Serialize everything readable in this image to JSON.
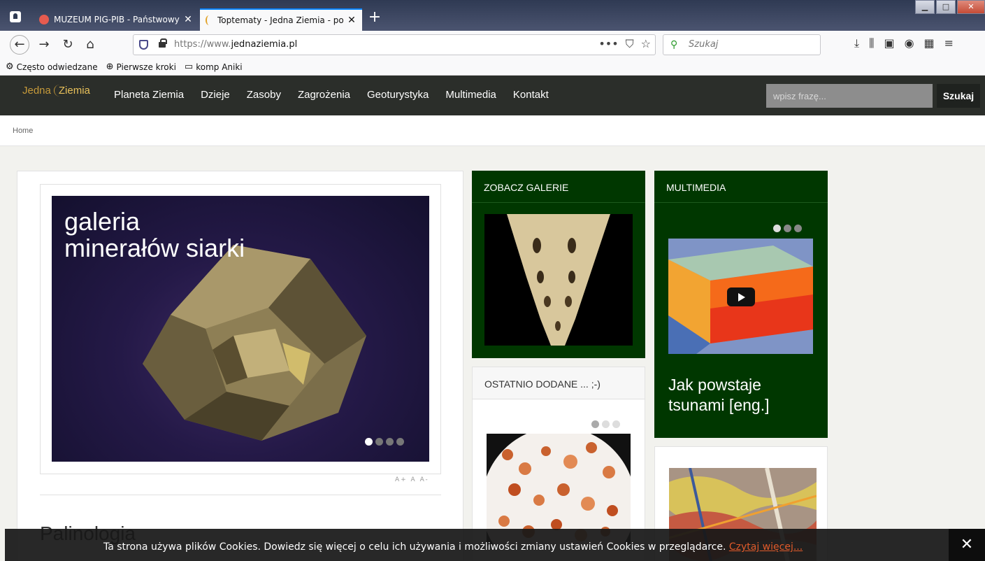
{
  "browser": {
    "tabs": [
      {
        "label": "MUZEUM PIG-PIB - Państwowy",
        "active": false
      },
      {
        "label": "Toptematy - Jedna Ziemia - po",
        "active": true
      }
    ],
    "url_proto": "https://www.",
    "url_host": "jednaziemia.pl",
    "search_placeholder": "Szukaj",
    "bookmarks": [
      "Często odwiedzane",
      "Pierwsze kroki",
      "komp Aniki"
    ]
  },
  "site": {
    "logo_part1": "Jedna",
    "logo_part2": "Ziemia",
    "nav": [
      "Planeta Ziemia",
      "Dzieje",
      "Zasoby",
      "Zagrożenia",
      "Geoturystyka",
      "Multimedia",
      "Kontakt"
    ],
    "search_placeholder": "wpisz frazę...",
    "search_button": "Szukaj",
    "breadcrumb": "Home"
  },
  "main": {
    "slider_title_line1": "galeria",
    "slider_title_line2": "minerałów siarki",
    "font_tools": "A+  A  A-",
    "next_heading": "Palinologia"
  },
  "cards": {
    "gallery_title": "ZOBACZ GALERIE",
    "multimedia_title": "MULTIMEDIA",
    "multimedia_caption_line1": "Jak powstaje",
    "multimedia_caption_line2": "tsunami [eng.]",
    "recent_title": "OSTATNIO DODANE ... ;-)"
  },
  "cookie": {
    "text": "Ta strona używa plików Cookies. Dowiedz się więcej o celu ich używania i możliwości zmiany ustawień Cookies w przeglądarce. ",
    "link": "Czytaj więcej...",
    "close": "✕"
  },
  "colors": {
    "header_bg": "#2b2e2a",
    "card_green": "#003700",
    "logo_gold": "#c69a3a",
    "cookie_link": "#e05a2a"
  }
}
